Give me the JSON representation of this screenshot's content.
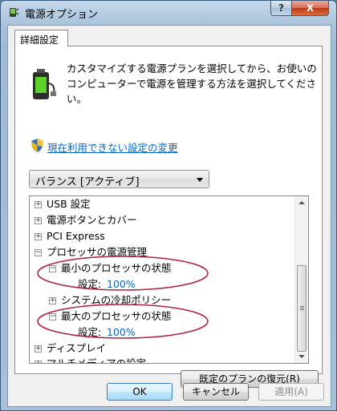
{
  "window": {
    "title": "電源オプション"
  },
  "titlebar": {
    "help_label": "?",
    "close_label": "X"
  },
  "tab": {
    "label": "詳細設定"
  },
  "description": "カスタマイズする電源プランを選択してから、お使いのコンピューターで電源を管理する方法を選択してください。",
  "link": {
    "label": "現在利用できない設定の変更"
  },
  "plan_select": {
    "value": "バランス [アクティブ]"
  },
  "tree": {
    "items": [
      {
        "label": "USB 設定",
        "expander": "+"
      },
      {
        "label": "電源ボタンとカバー",
        "expander": "+"
      },
      {
        "label": "PCI Express",
        "expander": "+"
      },
      {
        "label": "プロセッサの電源管理",
        "expander": "−"
      },
      {
        "label": "最小のプロセッサの状態",
        "expander": "−"
      },
      {
        "label": "設定:",
        "value": "100%"
      },
      {
        "label": "システムの冷却ポリシー",
        "expander": "+"
      },
      {
        "label": "最大のプロセッサの状態",
        "expander": "−"
      },
      {
        "label": "設定:",
        "value": "100%"
      },
      {
        "label": "ディスプレイ",
        "expander": "+"
      },
      {
        "label": "マルチメディアの設定",
        "expander": "+"
      }
    ]
  },
  "buttons": {
    "restore": "既定のプランの復元(R)",
    "ok": "OK",
    "cancel": "キャンセル",
    "apply": "適用(A)"
  },
  "colors": {
    "accent": "#0066cc",
    "annotation": "#b0203a"
  },
  "icons": {
    "app": "power-options-icon",
    "power": "battery-plug-icon",
    "shield": "uac-shield-icon"
  }
}
